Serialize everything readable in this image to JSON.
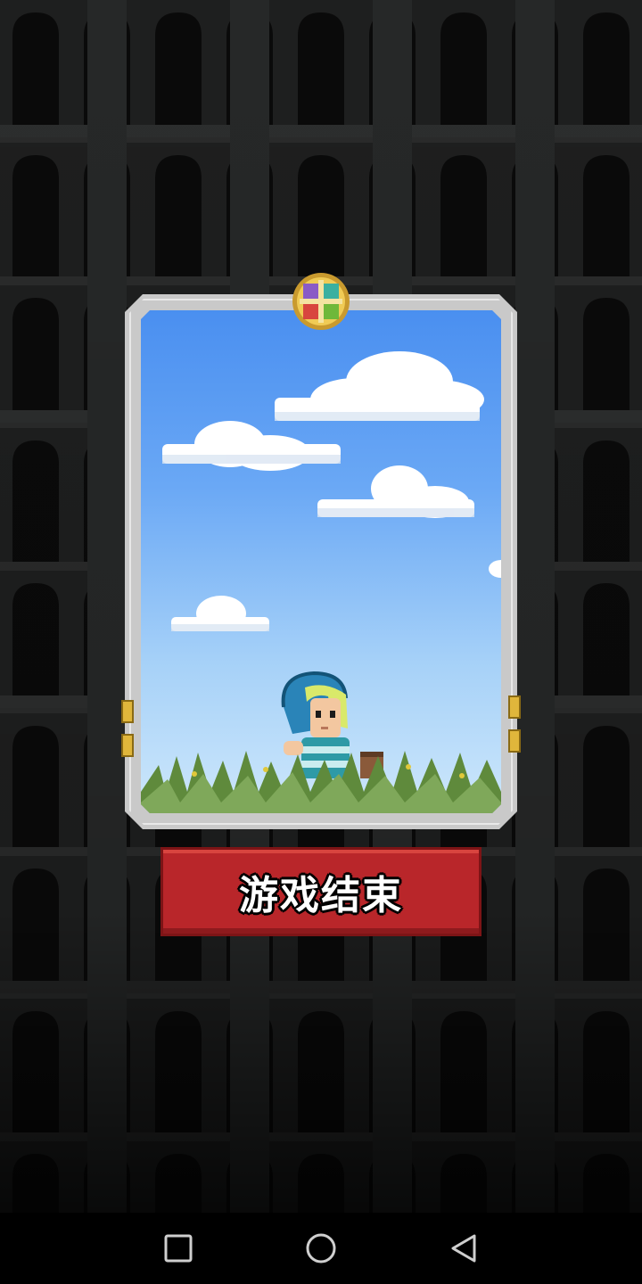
{
  "game_over": {
    "button_label": "游戏结束"
  },
  "card": {
    "scene": "hero-standing-in-grass-under-blue-sky",
    "frame_color": "#c9c9c9",
    "sky_top_color": "#4a8ff0",
    "sky_bottom_color": "#cde7fb"
  },
  "colors": {
    "button_red": "#b9262a",
    "background": "#1a1a1a"
  },
  "navbar": {
    "buttons": [
      "recent-apps",
      "home",
      "back"
    ]
  }
}
